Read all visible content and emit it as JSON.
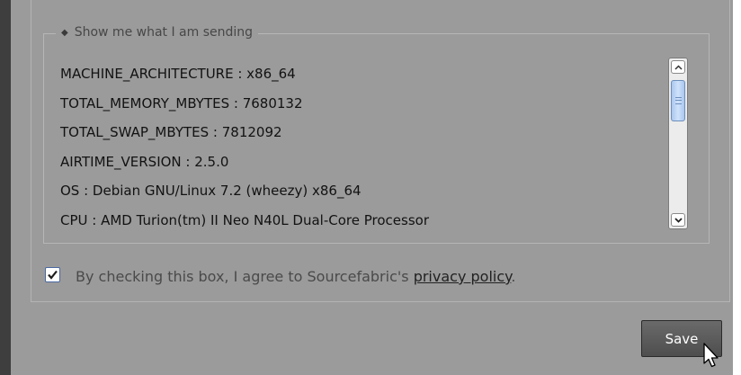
{
  "system_info": {
    "legend_label": "Show me what I am sending",
    "lines": [
      "MACHINE_ARCHITECTURE : x86_64",
      "TOTAL_MEMORY_MBYTES : 7680132",
      "TOTAL_SWAP_MBYTES : 7812092",
      "AIRTIME_VERSION : 2.5.0",
      "OS : Debian GNU/Linux 7.2 (wheezy) x86_64",
      "CPU : AMD Turion(tm) II Neo N40L Dual-Core Processor"
    ]
  },
  "privacy": {
    "checked": true,
    "text": "By checking this box, I agree to Sourcefabric's ",
    "link_label": "privacy policy",
    "period": "."
  },
  "actions": {
    "save_label": "Save"
  },
  "colors": {
    "panel": "#9b9b9b",
    "checkbox_border": "#4a68a0",
    "scroll_thumb": "#a9c7ef",
    "button": "#5a5a5a"
  }
}
